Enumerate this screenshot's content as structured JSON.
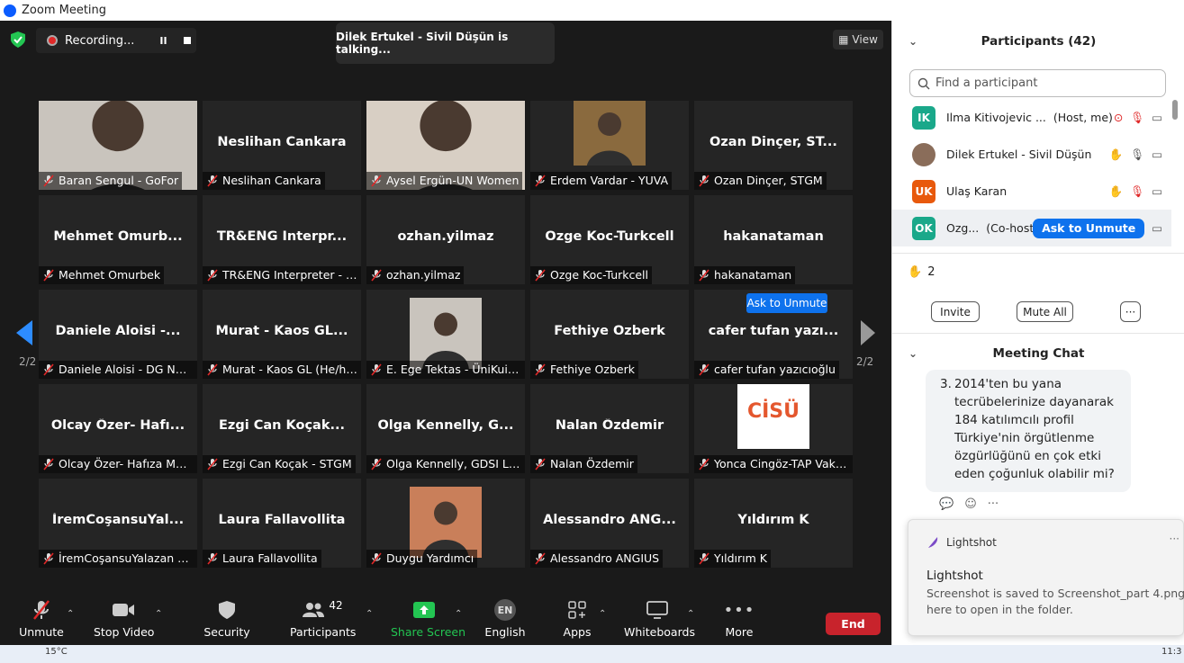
{
  "window": {
    "title": "Zoom Meeting"
  },
  "recording": {
    "label": "Recording...",
    "pause": "II"
  },
  "talking": "Dilek Ertukel - Sivil Düşün is talking...",
  "view_label": "View",
  "page_indicator": "2/2",
  "ask_to_unmute_popup": "Ask to Unmute",
  "tiles": [
    {
      "big": "",
      "label": "Baran Sengul - GoFor",
      "photo": true
    },
    {
      "big": "Neslihan Cankara",
      "label": "Neslihan Cankara"
    },
    {
      "big": "",
      "label": "Aysel Ergün-UN Women",
      "photo": true
    },
    {
      "big": "",
      "label": "Erdem Vardar - YUVA",
      "photo": true
    },
    {
      "big": "Ozan Dinçer, ST...",
      "label": "Ozan Dinçer, STGM"
    },
    {
      "big": "Mehmet  Omurb...",
      "label": "Mehmet Omurbek"
    },
    {
      "big": "TR&ENG  Interpr...",
      "label": "TR&ENG Interpreter - Gam..."
    },
    {
      "big": "ozhan.yilmaz",
      "label": "ozhan.yilmaz"
    },
    {
      "big": "Ozge Koc-Turkcell",
      "label": "Ozge Koc-Turkcell"
    },
    {
      "big": "hakanataman",
      "label": "hakanataman"
    },
    {
      "big": "Daniele Aloisi -...",
      "label": "Daniele Aloisi - DG NEAR"
    },
    {
      "big": "Murat - Kaos GL...",
      "label": "Murat - Kaos GL (He/him)"
    },
    {
      "big": "",
      "label": "E. Ege Tektas - ÜniKuir ...",
      "photo": true
    },
    {
      "big": "Fethiye Ozberk",
      "label": "Fethiye Ozberk"
    },
    {
      "big": "cafer  tufan  yazı...",
      "label": "cafer tufan yazıcıoğlu"
    },
    {
      "big": "Olcay  Özer-  Hafı...",
      "label": "Olcay Özer- Hafıza Mer..."
    },
    {
      "big": "Ezgi  Can  Koçak...",
      "label": "Ezgi Can Koçak - STGM"
    },
    {
      "big": "Olga  Kennelly,  G...",
      "label": "Olga Kennelly, GDSI Limi..."
    },
    {
      "big": "Nalan Özdemir",
      "label": "Nalan Özdemir"
    },
    {
      "big": "",
      "label": "Yonca Cingöz-TAP Vakfı/...",
      "photo": true,
      "logo": "CİSÜ"
    },
    {
      "big": "İremCoşansuYal...",
      "label": "İremCoşansuYalazan En..."
    },
    {
      "big": "Laura Fallavollita",
      "label": "Laura Fallavollita"
    },
    {
      "big": "",
      "label": "Duygu Yardımcı",
      "photo": true
    },
    {
      "big": "Alessandro  ANG...",
      "label": "Alessandro ANGIUS"
    },
    {
      "big": "Yıldırım K",
      "label": "Yıldırım K"
    }
  ],
  "toolbar": {
    "unmute": "Unmute",
    "stop_video": "Stop Video",
    "security": "Security",
    "participants": "Participants",
    "participants_count": "42",
    "share": "Share Screen",
    "english": "English",
    "english_badge": "EN",
    "apps": "Apps",
    "whiteboards": "Whiteboards",
    "more": "More",
    "end": "End"
  },
  "participants_panel": {
    "title": "Participants (42)",
    "search_placeholder": "Find a participant",
    "rows": [
      {
        "initials": "IK",
        "name": "Ilma Kitivojevic ...",
        "role": "(Host, me)",
        "color": "#1aa88a"
      },
      {
        "initials": "",
        "name": "Dilek Ertukel - Sivil Düşün",
        "role": "",
        "color": "#8a6d5a"
      },
      {
        "initials": "UK",
        "name": "Ulaş Karan",
        "role": "",
        "color": "#e8590c"
      },
      {
        "initials": "OK",
        "name": "Ozg...",
        "role": "(Co-host)",
        "color": "#1aa88a"
      }
    ],
    "ask_to_unmute": "Ask to Unmute",
    "raised_hands": "2",
    "invite": "Invite",
    "mute_all": "Mute All",
    "more": "···"
  },
  "chat": {
    "title": "Meeting Chat",
    "item_number": "3.",
    "message": "2014'ten bu yana tecrübelerinize dayanarak 184 katılımcılı profil Türkiye'nin örgütlenme özgürlüğünü en çok etki eden çoğunluk olabilir mi?"
  },
  "toast": {
    "app": "Lightshot",
    "title": "Lightshot",
    "line1": "Screenshot is saved to Screenshot_part 4.png.",
    "line2": "here to open in the folder."
  },
  "taskbar": {
    "temp": "15°C",
    "clock": "11:3"
  }
}
